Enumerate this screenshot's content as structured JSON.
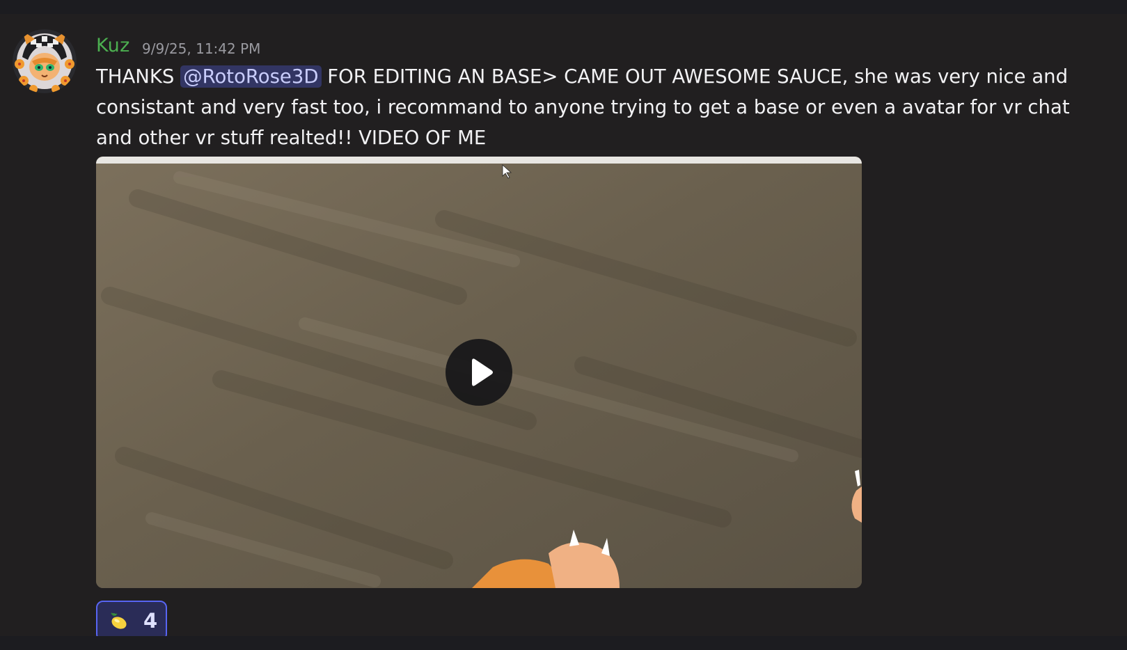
{
  "message": {
    "author": "Kuz",
    "timestamp": "9/9/25, 11:42 PM",
    "text_before_mention": "THANKS ",
    "mention": "@RotoRose3D",
    "text_after_mention": " FOR EDITING AN BASE> CAME OUT AWESOME SAUCE, she was very nice and consistant and very fast too, i recommand to anyone trying to get a base or even a avatar for vr chat and other vr stuff realted!! VIDEO OF ME",
    "author_color": "#4caf50",
    "mention_color": "#c9cdfb"
  },
  "attachment": {
    "type": "video",
    "play_icon": "play-icon"
  },
  "reactions": [
    {
      "emoji": "lemon",
      "count": "4",
      "active": true
    }
  ],
  "colors": {
    "background": "#211f20",
    "accent": "#5865f2"
  }
}
